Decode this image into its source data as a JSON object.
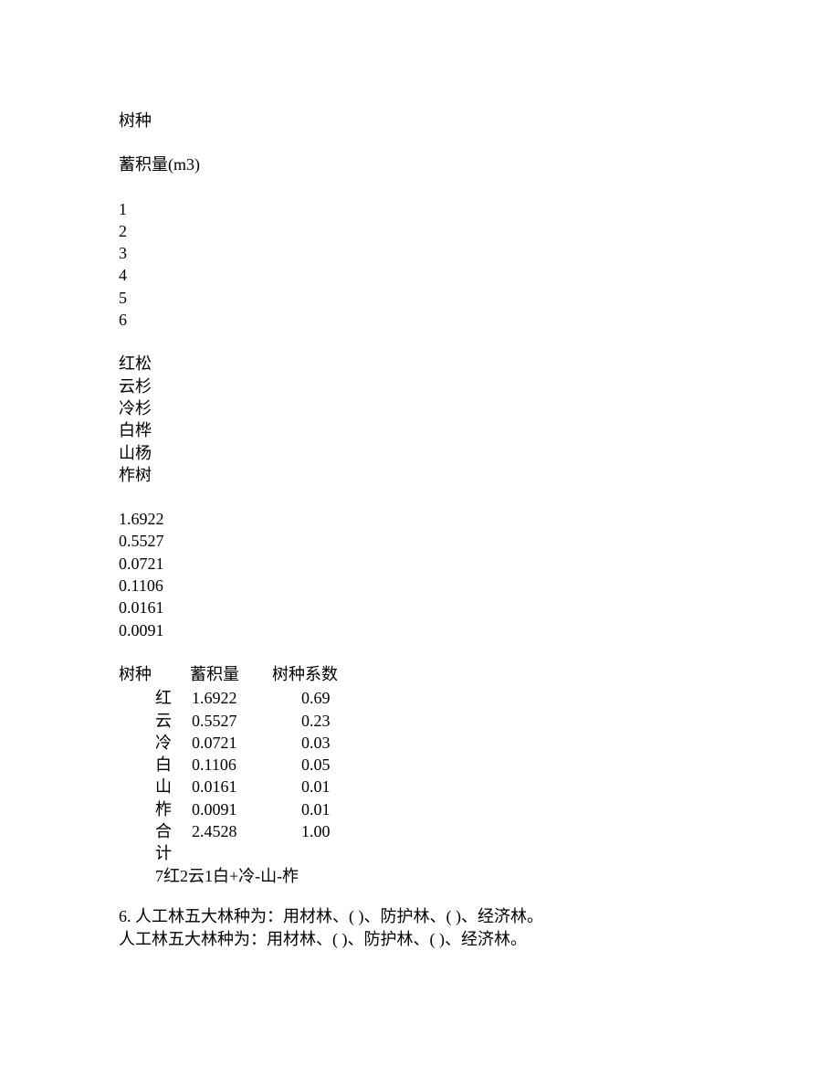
{
  "headers": {
    "species": "树种",
    "volume": "蓄积量(m3)"
  },
  "numbers": [
    "1",
    "2",
    "3",
    "4",
    "5",
    "6"
  ],
  "species_names": [
    "红松",
    "云杉",
    "冷杉",
    "白桦",
    "山杨",
    "柞树"
  ],
  "volumes": [
    "1.6922",
    "0.5527",
    "0.0721",
    "0.1106",
    "0.0161",
    "0.0091"
  ],
  "chart_data": {
    "type": "table",
    "headers": {
      "species": "树种",
      "volume": "蓄积量",
      "coefficient": "树种系数"
    },
    "rows": [
      {
        "species": "红",
        "volume": "1.6922",
        "coefficient": "0.69"
      },
      {
        "species": "云",
        "volume": "0.5527",
        "coefficient": "0.23"
      },
      {
        "species": "冷",
        "volume": "0.0721",
        "coefficient": "0.03"
      },
      {
        "species": "白",
        "volume": "0.1106",
        "coefficient": "0.05"
      },
      {
        "species": "山",
        "volume": "0.0161",
        "coefficient": "0.01"
      },
      {
        "species": "柞",
        "volume": "0.0091",
        "coefficient": "0.01"
      },
      {
        "species": "合计",
        "volume": "2.4528",
        "coefficient": "1.00"
      }
    ],
    "formula": "7红2云1白+冷-山-柞"
  },
  "question6": {
    "line1": "6. 人工林五大林种为：用材林、(  )、防护林、(  )、经济林。",
    "line2": "人工林五大林种为：用材林、(  )、防护林、(  )、经济林。"
  }
}
